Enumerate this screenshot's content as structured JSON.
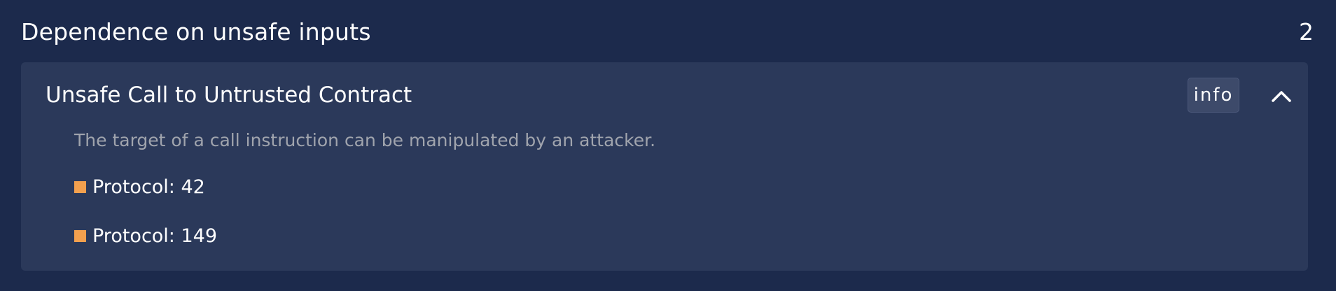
{
  "section": {
    "title": "Dependence on unsafe inputs",
    "count": "2"
  },
  "issue": {
    "title": "Unsafe Call to Untrusted Contract",
    "badge": "info",
    "description": "The target of a call instruction can be manipulated by an attacker.",
    "items": [
      {
        "label": "Protocol: 42"
      },
      {
        "label": "Protocol: 149"
      }
    ],
    "expanded": true
  },
  "colors": {
    "background": "#1c2a4c",
    "card": "#2b395a",
    "badge_bg": "#3d4a6a",
    "marker": "#f3a04e",
    "description_text": "#a0a4ad"
  },
  "icons": {
    "collapse": "chevron-up-icon",
    "item_marker": "square-marker-icon"
  }
}
